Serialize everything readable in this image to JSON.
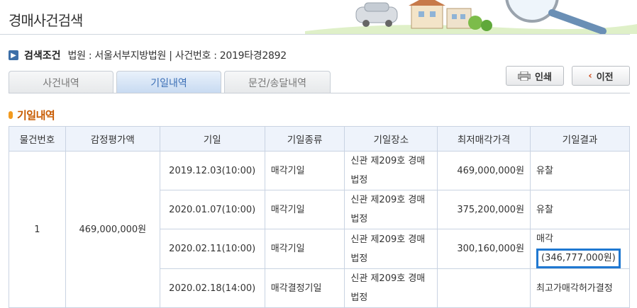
{
  "header": {
    "title": "경매사건검색"
  },
  "search_condition": {
    "label": "검색조건",
    "text": "법원 : 서울서부지방법원 | 사건번호 : 2019타경2892"
  },
  "tabs": [
    {
      "label": "사건내역",
      "active": false
    },
    {
      "label": "기일내역",
      "active": true
    },
    {
      "label": "문건/송달내역",
      "active": false
    }
  ],
  "buttons": {
    "print": "인쇄",
    "prev": "이전"
  },
  "section_title": "기일내역",
  "table": {
    "columns": [
      "물건번호",
      "감정평가액",
      "기일",
      "기일종류",
      "기일장소",
      "최저매각가격",
      "기일결과"
    ],
    "item_no": "1",
    "appraisal": "469,000,000원",
    "rows": [
      {
        "date": "2019.12.03(10:00)",
        "type": "매각기일",
        "place": "신관 제209호 경매법정",
        "min_price": "469,000,000원",
        "result": "유찰",
        "result_detail": ""
      },
      {
        "date": "2020.01.07(10:00)",
        "type": "매각기일",
        "place": "신관 제209호 경매법정",
        "min_price": "375,200,000원",
        "result": "유찰",
        "result_detail": ""
      },
      {
        "date": "2020.02.11(10:00)",
        "type": "매각기일",
        "place": "신관 제209호 경매법정",
        "min_price": "300,160,000원",
        "result": "매각",
        "result_detail": "(346,777,000원)"
      },
      {
        "date": "2020.02.18(14:00)",
        "type": "매각결정기일",
        "place": "신관 제209호 경매법정",
        "min_price": "",
        "result": "최고가매각허가결정",
        "result_detail": ""
      }
    ]
  },
  "colors": {
    "accent": "#3b6fb6",
    "highlight": "#1f78d1",
    "section": "#c85a00"
  }
}
